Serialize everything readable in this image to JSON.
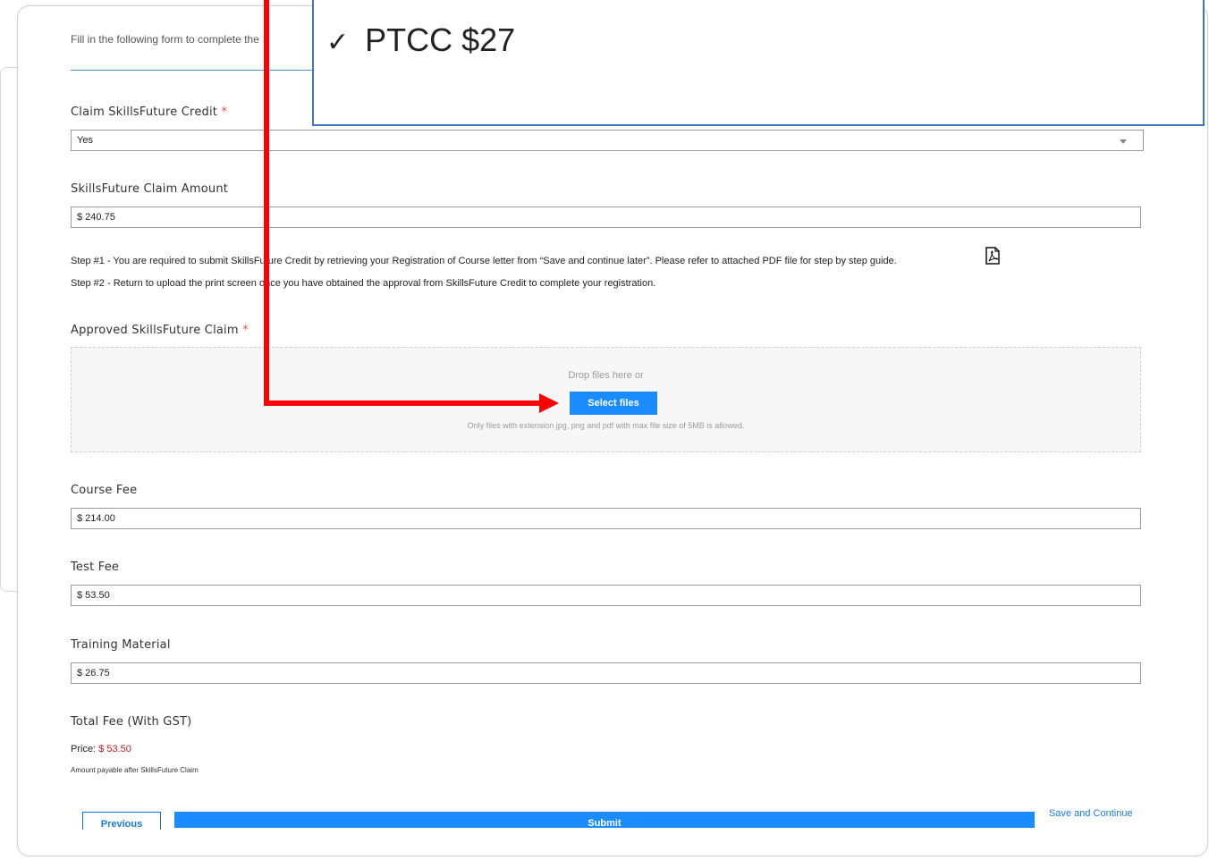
{
  "intro_text": "Fill in the following form to complete the",
  "callout": {
    "check": "✓",
    "text": "PTCC $27"
  },
  "claim_sf": {
    "label": "Claim SkillsFuture Credit",
    "required": "*",
    "value": "Yes"
  },
  "sf_amount": {
    "label": "SkillsFuture Claim Amount",
    "value": "$ 240.75"
  },
  "steps": {
    "step1": "Step #1 - You are required to submit SkillsFuture Credit by retrieving your Registration of Course letter from “Save and continue later”. Please refer to attached PDF file for step by step guide.",
    "step2": "Step #2 - Return to upload the print screen once you have obtained the approval from SkillsFuture Credit to complete your registration."
  },
  "approved_claim": {
    "label": "Approved SkillsFuture Claim",
    "required": "*",
    "drop_text": "Drop files here or",
    "button": "Select files",
    "note": "Only files with extension jpg, png and pdf with max file size of 5MB is allowed."
  },
  "course_fee": {
    "label": "Course Fee",
    "value": "$ 214.00"
  },
  "test_fee": {
    "label": "Test Fee",
    "value": "$ 53.50"
  },
  "training_material": {
    "label": "Training Material",
    "value": "$ 26.75"
  },
  "total_fee": {
    "label": "Total Fee (With GST)",
    "price_label": "Price:",
    "price_value": "$ 53.50",
    "note": "Amount payable after SkillsFuture Claim"
  },
  "buttons": {
    "previous": "Previous",
    "submit": "Submit",
    "save": "Save and Continue"
  },
  "colors": {
    "accent": "#1a8cff",
    "annotation": "#ff0000",
    "callout_border": "#4472c4",
    "price": "#b22222"
  },
  "icons": {
    "pdf": "pdf-file-icon",
    "dropdown": "chevron-down-icon",
    "check": "check-icon"
  }
}
